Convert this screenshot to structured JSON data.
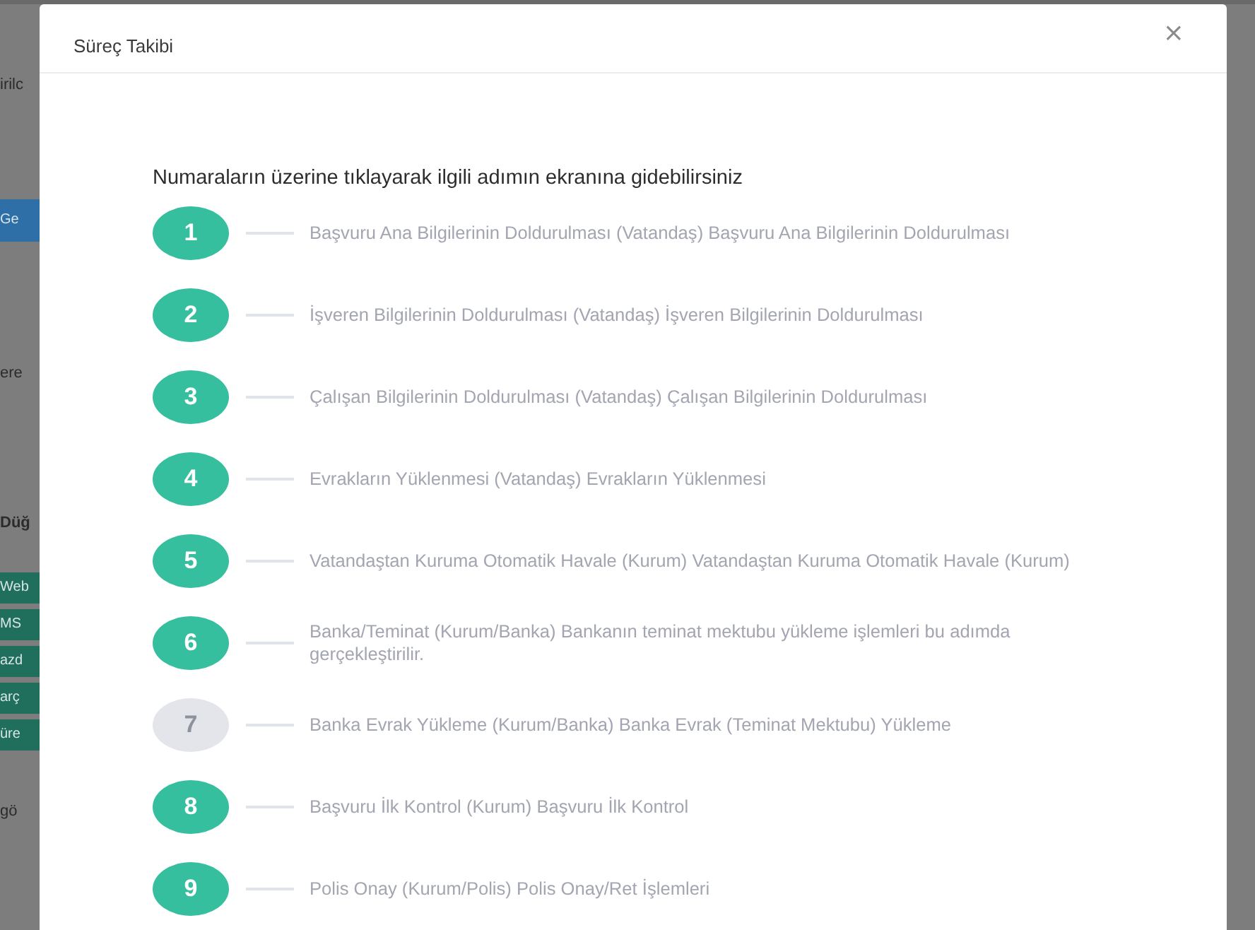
{
  "background_page": {
    "fragments": [
      {
        "kind": "text",
        "text": "irilc"
      },
      {
        "kind": "button",
        "text": "Ge",
        "color": "#2f6fa8"
      },
      {
        "kind": "text",
        "text": "ere"
      },
      {
        "kind": "heading",
        "text": "Düğ"
      },
      {
        "kind": "button",
        "text": "Web",
        "color": "#1f6f5c"
      },
      {
        "kind": "button",
        "text": "MS",
        "color": "#1f6f5c"
      },
      {
        "kind": "button",
        "text": "azd",
        "color": "#1f6f5c"
      },
      {
        "kind": "button",
        "text": "arç",
        "color": "#1f6f5c"
      },
      {
        "kind": "button",
        "text": "üre",
        "color": "#1f6f5c"
      },
      {
        "kind": "text",
        "text": "gö"
      }
    ]
  },
  "modal": {
    "title": "Süreç Takibi",
    "close": "×",
    "instruction": "Numaraların üzerine tıklayarak ilgili adımın ekranına gidebilirsiniz",
    "steps": [
      {
        "number": "1",
        "text": "Başvuru Ana Bilgilerinin Doldurulması (Vatandaş) Başvuru Ana Bilgilerinin Doldurulması",
        "disabled": false
      },
      {
        "number": "2",
        "text": "İşveren Bilgilerinin Doldurulması (Vatandaş) İşveren Bilgilerinin Doldurulması",
        "disabled": false
      },
      {
        "number": "3",
        "text": "Çalışan Bilgilerinin Doldurulması (Vatandaş) Çalışan Bilgilerinin Doldurulması",
        "disabled": false
      },
      {
        "number": "4",
        "text": "Evrakların Yüklenmesi (Vatandaş) Evrakların Yüklenmesi",
        "disabled": false
      },
      {
        "number": "5",
        "text": "Vatandaştan Kuruma Otomatik Havale (Kurum) Vatandaştan Kuruma Otomatik Havale (Kurum)",
        "disabled": false
      },
      {
        "number": "6",
        "text": "Banka/Teminat (Kurum/Banka) Bankanın teminat mektubu yükleme işlemleri bu adımda gerçekleştirilir.",
        "disabled": false
      },
      {
        "number": "7",
        "text": "Banka Evrak Yükleme (Kurum/Banka) Banka Evrak (Teminat Mektubu) Yükleme",
        "disabled": true
      },
      {
        "number": "8",
        "text": "Başvuru İlk Kontrol (Kurum) Başvuru İlk Kontrol",
        "disabled": false
      },
      {
        "number": "9",
        "text": "Polis Onay (Kurum/Polis) Polis Onay/Ret İşlemleri",
        "disabled": false
      }
    ]
  }
}
